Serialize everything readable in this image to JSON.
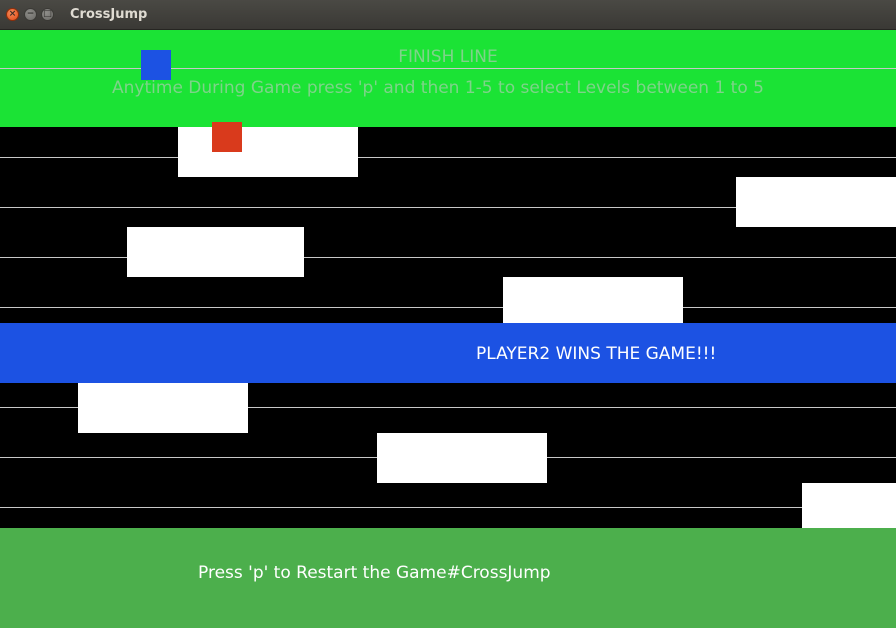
{
  "window": {
    "title": "CrossJump",
    "controls": [
      {
        "name": "close-button",
        "icon": "close-icon",
        "glyph": "×"
      },
      {
        "name": "minimize-button",
        "icon": "minimize-icon",
        "glyph": "−"
      },
      {
        "name": "maximize-button",
        "icon": "maximize-icon",
        "glyph": "□"
      }
    ]
  },
  "game": {
    "finish_label": "FINISH LINE",
    "instruction": "Anytime During Game press 'p' and then 1-5 to select Levels between 1 to 5",
    "win_message": "PLAYER2 WINS THE GAME!!!",
    "restart_message": "Press 'p' to Restart the Game#CrossJump"
  },
  "colors": {
    "finish_zone": "#1be335",
    "finish_text": "#7fd38a",
    "banner": "#1c52e3",
    "footer": "#4caf4c",
    "player1": "#1c52e3",
    "player2": "#d93a1c",
    "block": "#ffffff",
    "lane_line": "#c8c8c8"
  }
}
